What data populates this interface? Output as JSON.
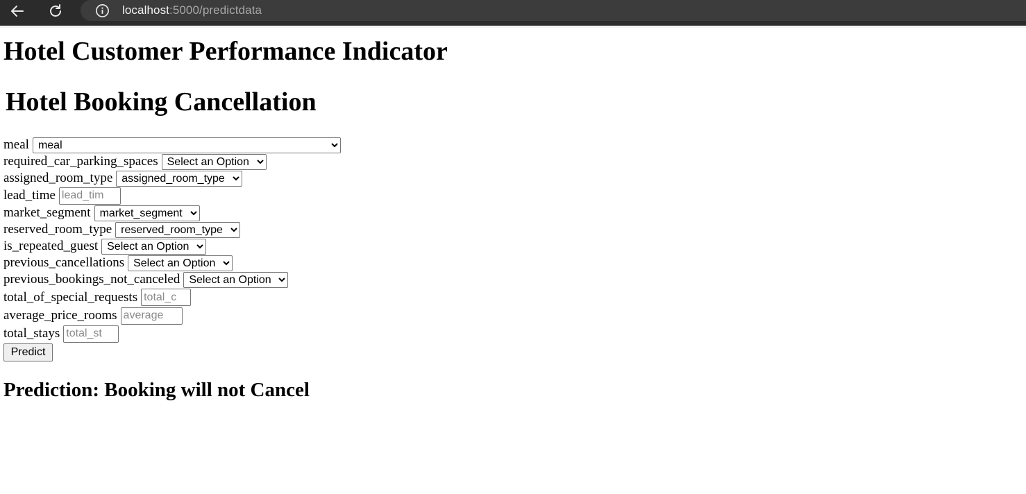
{
  "browser": {
    "url_host": "localhost",
    "url_rest": ":5000/predictdata"
  },
  "page": {
    "site_title": "Hotel Customer Performance Indicator",
    "form_title": "Hotel Booking Cancellation"
  },
  "form": {
    "meal": {
      "label": "meal",
      "selected": "meal"
    },
    "required_car_parking_spaces": {
      "label": "required_car_parking_spaces",
      "selected": "Select an Option"
    },
    "assigned_room_type": {
      "label": "assigned_room_type",
      "selected": "assigned_room_type"
    },
    "lead_time": {
      "label": "lead_time",
      "placeholder": "lead_tim"
    },
    "market_segment": {
      "label": "market_segment",
      "selected": "market_segment"
    },
    "reserved_room_type": {
      "label": "reserved_room_type",
      "selected": "reserved_room_type"
    },
    "is_repeated_guest": {
      "label": "is_repeated_guest",
      "selected": "Select an Option"
    },
    "previous_cancellations": {
      "label": "previous_cancellations",
      "selected": "Select an Option"
    },
    "previous_bookings_not_canceled": {
      "label": "previous_bookings_not_canceled",
      "selected": "Select an Option"
    },
    "total_of_special_requests": {
      "label": "total_of_special_requests",
      "placeholder": "total_c"
    },
    "average_price_rooms": {
      "label": "average_price_rooms",
      "placeholder": "average"
    },
    "total_stays": {
      "label": "total_stays",
      "placeholder": "total_st"
    },
    "submit_label": "Predict"
  },
  "result": {
    "text": "Prediction: Booking will not Cancel"
  }
}
